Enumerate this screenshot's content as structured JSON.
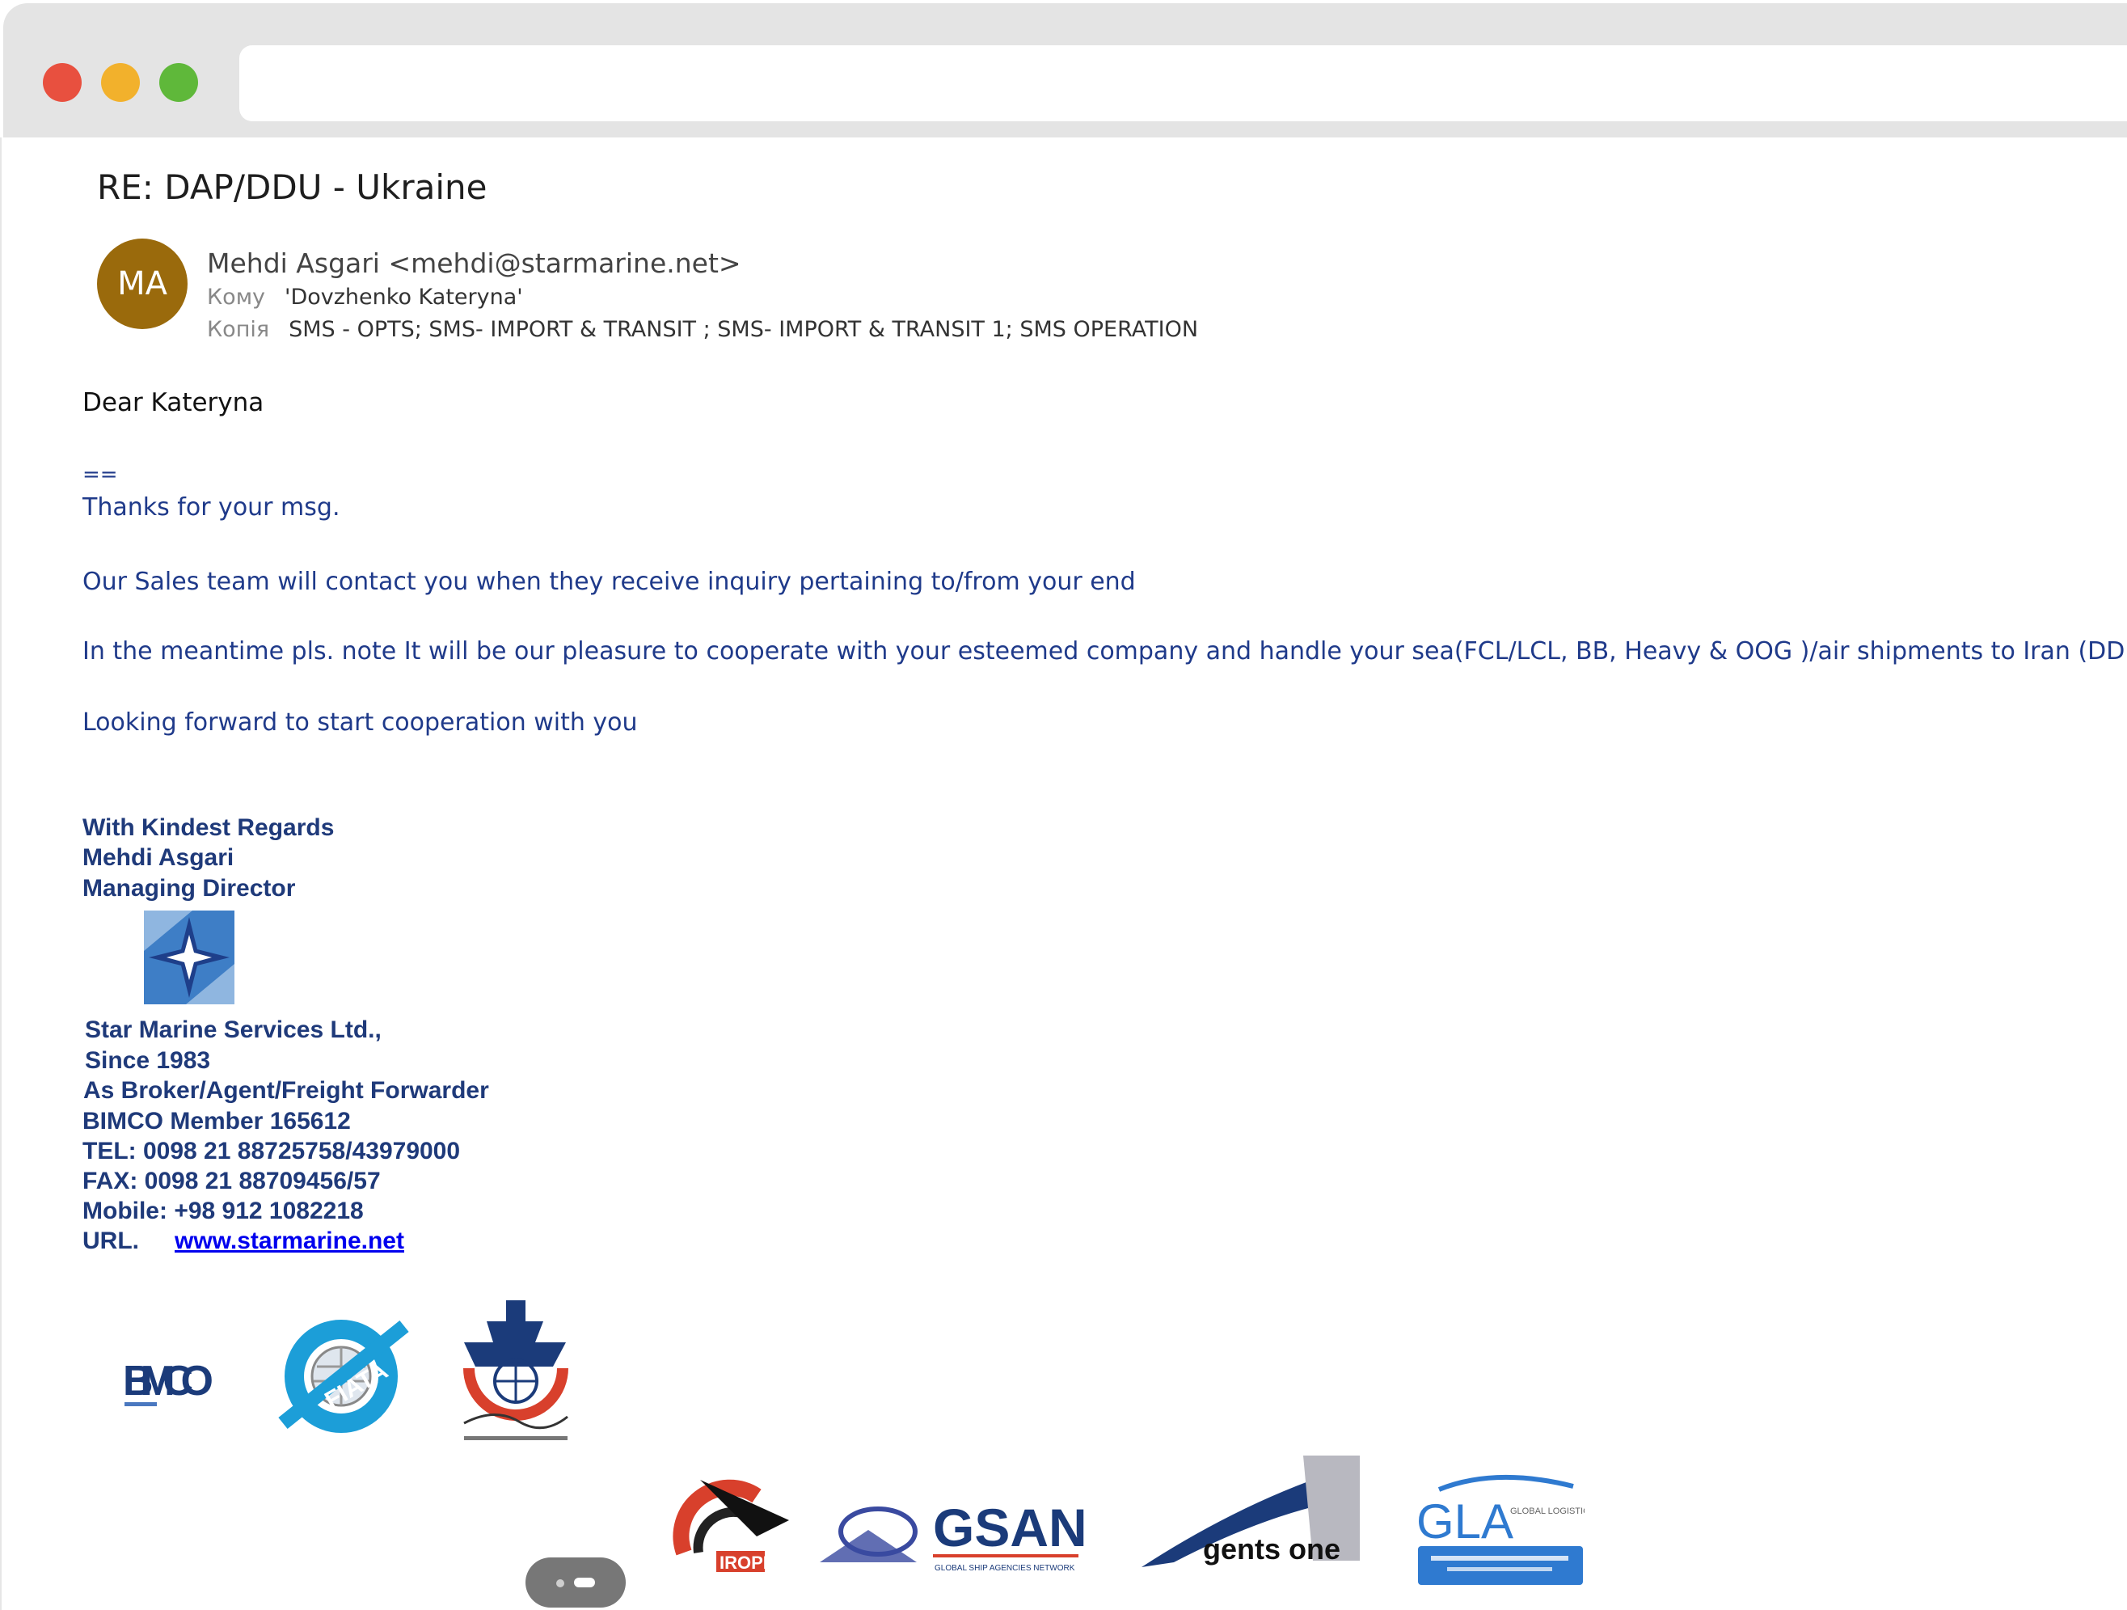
{
  "window": {
    "controls": [
      {
        "name": "close",
        "color": "#e8503f"
      },
      {
        "name": "minimize",
        "color": "#f2b12c"
      },
      {
        "name": "maximize",
        "color": "#5fb83a"
      }
    ]
  },
  "email": {
    "subject": "RE: DAP/DDU - Ukraine",
    "avatar": {
      "initials": "MA",
      "color": "#9a6a0c"
    },
    "from": "Mehdi Asgari <mehdi@starmarine.net>",
    "to": {
      "label": "Кому",
      "value": "'Dovzhenko Kateryna'"
    },
    "cc": {
      "label": "Копія",
      "value": "SMS - OPTS; SMS- IMPORT & TRANSIT ; SMS- IMPORT & TRANSIT 1; SMS OPERATION"
    },
    "greeting": "Dear Kateryna",
    "body": [
      "==",
      "Thanks for your msg.",
      "Our Sales team will contact you when they receive inquiry pertaining to/from your end",
      "In the meantime pls. note It will be our pleasure to cooperate with your esteemed company and handle your sea(FCL/LCL, BB, Heavy & OOG )/air shipments to Iran (DDP/DDU) and transit",
      "Looking forward to start cooperation with you"
    ],
    "signature": {
      "regards": "With Kindest Regards",
      "name": "Mehdi Asgari",
      "title": "Managing Director",
      "company": "Star Marine Services Ltd.,",
      "since": "Since 1983",
      "role": "As Broker/Agent/Freight Forwarder",
      "bimco": "BIMCO Member 165612",
      "tel": "TEL: 0098 21 88725758/43979000",
      "fax": "FAX: 0098 21 88709456/57",
      "mobile": "Mobile: +98 912 1082218",
      "url_label": "URL.",
      "url": "www.starmarine.net"
    },
    "logos": {
      "bimco": "BIMCO",
      "fiata": "FIATA",
      "iropex": "IROPEX",
      "gsan": "GSAN",
      "gsan_sub": "GLOBAL SHIP AGENCIES NETWORK",
      "agents": "gents one",
      "gla": "GLA",
      "gla_sub": "GLOBAL LOGISTICS ALLIANCE"
    }
  }
}
